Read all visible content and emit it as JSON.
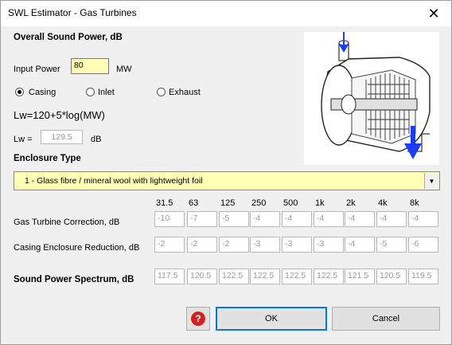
{
  "window": {
    "title": "SWL Estimator - Gas Turbines",
    "close_glyph": "✕"
  },
  "overall": {
    "heading": "Overall Sound Power, dB",
    "input_power_label": "Input Power",
    "input_power_value": "80",
    "input_power_unit": "MW",
    "radios": [
      {
        "label": "Casing",
        "selected": true
      },
      {
        "label": "Inlet",
        "selected": false
      },
      {
        "label": "Exhaust",
        "selected": false
      }
    ],
    "formula": "Lw=120+5*log(MW)",
    "lw_label": "Lw =",
    "lw_value": "129.5",
    "lw_unit": "dB"
  },
  "enclosure": {
    "heading": "Enclosure Type",
    "selected": "1 - Glass fibre / mineral wool with lightweight foil",
    "arrow_glyph": "▼"
  },
  "bands": {
    "headers": [
      "31.5",
      "63",
      "125",
      "250",
      "500",
      "1k",
      "2k",
      "4k",
      "8k"
    ],
    "rows": [
      {
        "label": "Gas Turbine Correction, dB",
        "values": [
          "-10",
          "-7",
          "-5",
          "-4",
          "-4",
          "-4",
          "-4",
          "-4",
          "-4"
        ]
      },
      {
        "label": "Casing Enclosure Reduction, dB",
        "values": [
          "-2",
          "-2",
          "-2",
          "-3",
          "-3",
          "-3",
          "-4",
          "-5",
          "-6"
        ]
      },
      {
        "label": "Sound Power Spectrum, dB",
        "values": [
          "117.5",
          "120.5",
          "122.5",
          "122.5",
          "122.5",
          "122.5",
          "121.5",
          "120.5",
          "119.5"
        ]
      }
    ]
  },
  "buttons": {
    "help_glyph": "?",
    "ok": "OK",
    "cancel": "Cancel"
  },
  "colors": {
    "highlight_yellow": "#ffffb5",
    "help_red": "#d42020",
    "arrow_blue": "#1a3cff"
  },
  "icons": {
    "help": "help-icon",
    "close": "close-icon",
    "turbine": "gas-turbine-illustration"
  }
}
